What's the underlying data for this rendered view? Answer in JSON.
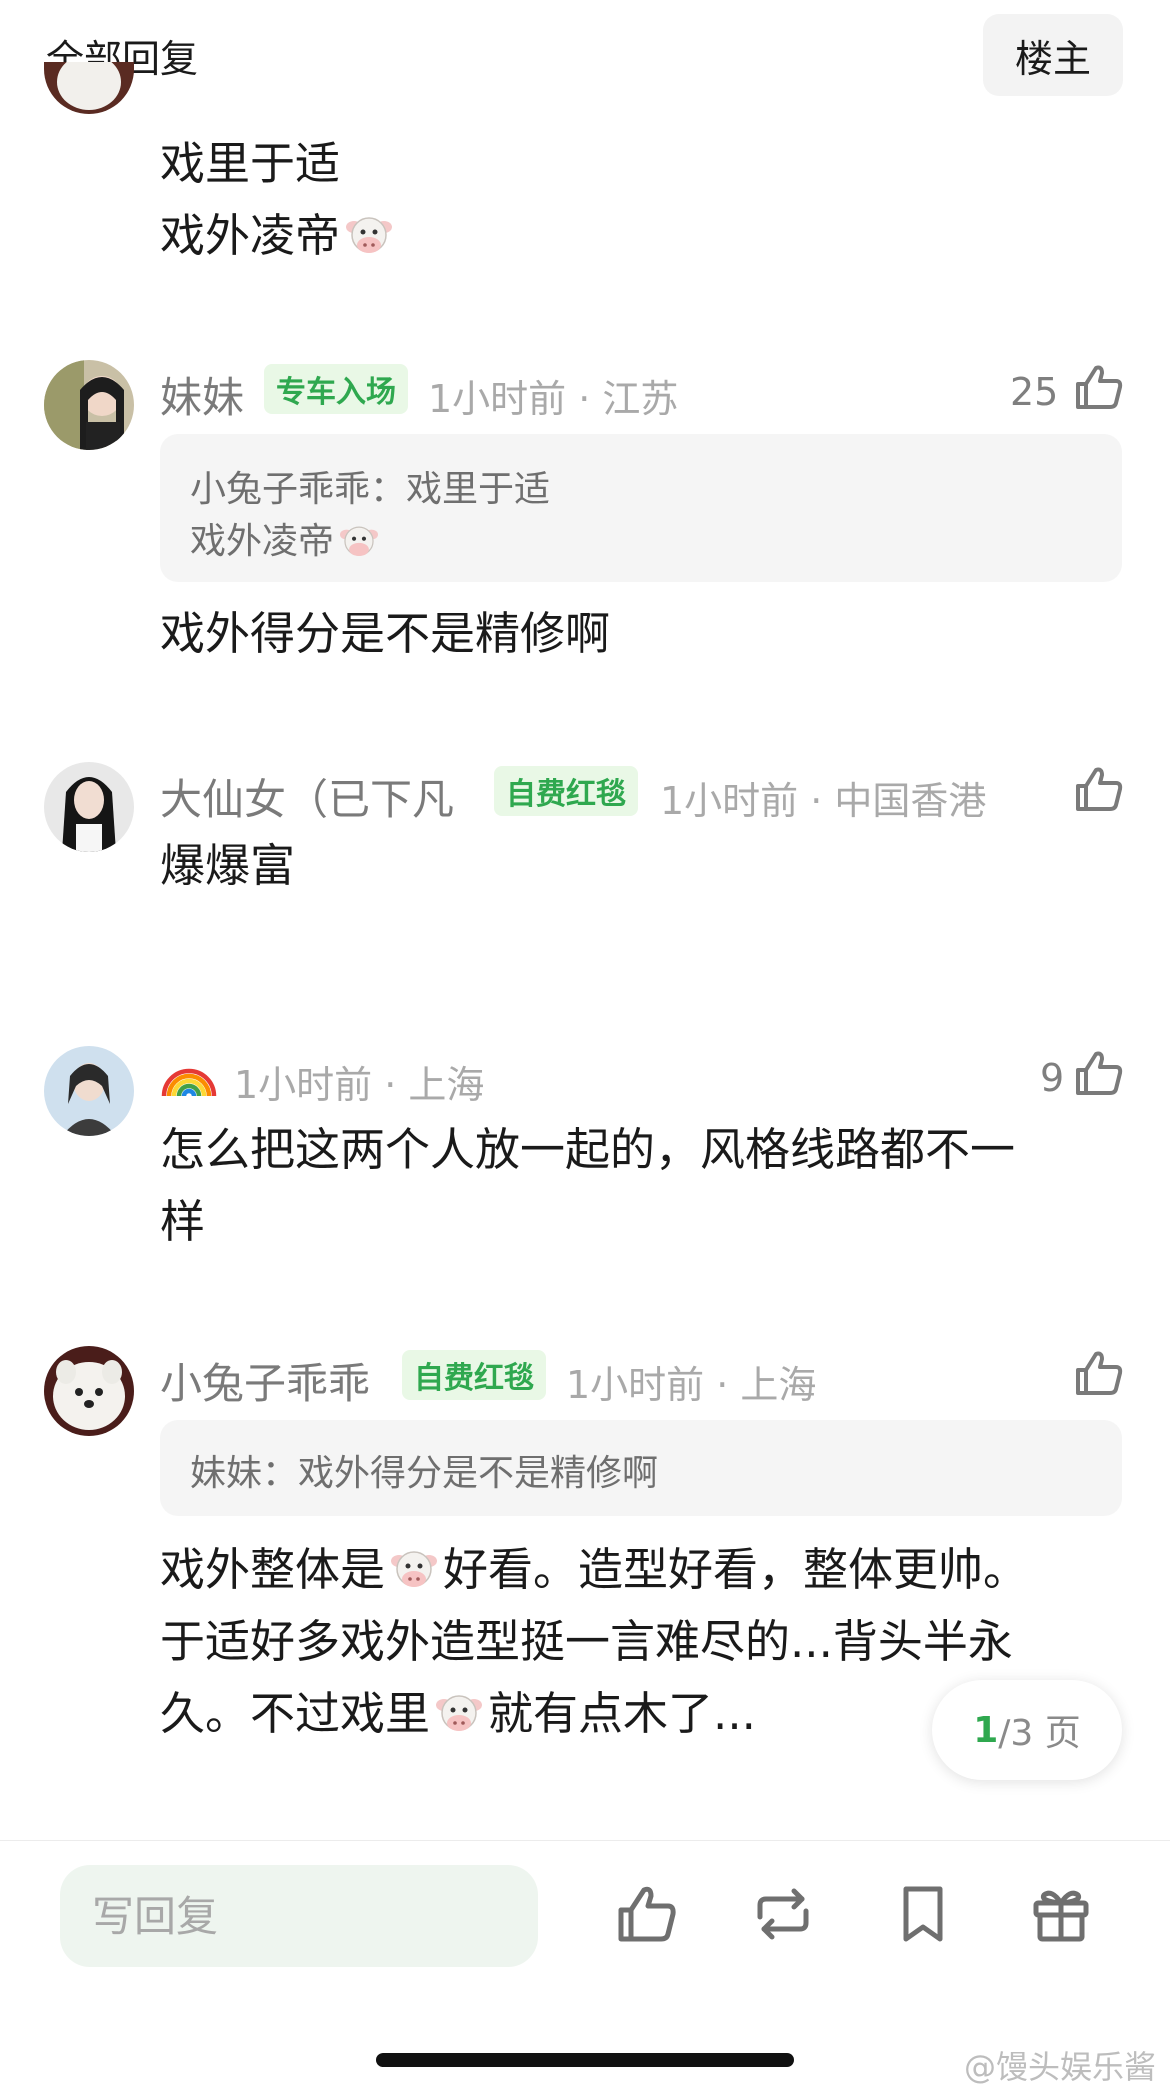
{
  "header": {
    "title": "全部回复",
    "op_button": "楼主"
  },
  "comments": [
    {
      "lines": [
        "戏里于适",
        "戏外凌帝"
      ]
    },
    {
      "name": "妹妹",
      "badge": "专车入场",
      "meta": "1小时前 · 江苏",
      "likes": "25",
      "quote": {
        "author": "小兔子乖乖：",
        "line1": "戏里于适",
        "line2": "戏外凌帝"
      },
      "text": "戏外得分是不是精修啊"
    },
    {
      "name": "大仙女（已下凡",
      "badge": "自费红毯",
      "meta": "1小时前 · 中国香港",
      "text": "爆爆富"
    },
    {
      "meta": "1小时前 · 上海",
      "likes": "9",
      "line1": "怎么把这两个人放一起的，风格线路都不一",
      "line2": "样"
    },
    {
      "name": "小兔子乖乖",
      "badge": "自费红毯",
      "meta": "1小时前 · 上海",
      "quote": {
        "author": "妹妹：",
        "text": "戏外得分是不是精修啊"
      },
      "line1_a": "戏外整体是",
      "line1_b": "好看。造型好看，整体更帅。",
      "line2": "于适好多戏外造型挺一言难尽的...背头半永",
      "line3_a": "久。不过戏里",
      "line3_b": "就有点木了..."
    }
  ],
  "pager": {
    "current": "1",
    "rest": "/3 页"
  },
  "bottom_bar": {
    "reply_placeholder": "写回复"
  },
  "watermark": "@馒头娱乐酱",
  "icons": [
    "like-icon",
    "repost-icon",
    "bookmark-icon",
    "gift-icon",
    "cow-emoji",
    "rainbow-emoji"
  ],
  "colors": {
    "accent_green": "#2fa84f",
    "badge_bg": "#e9f8e6",
    "muted": "#a9a9a9"
  }
}
